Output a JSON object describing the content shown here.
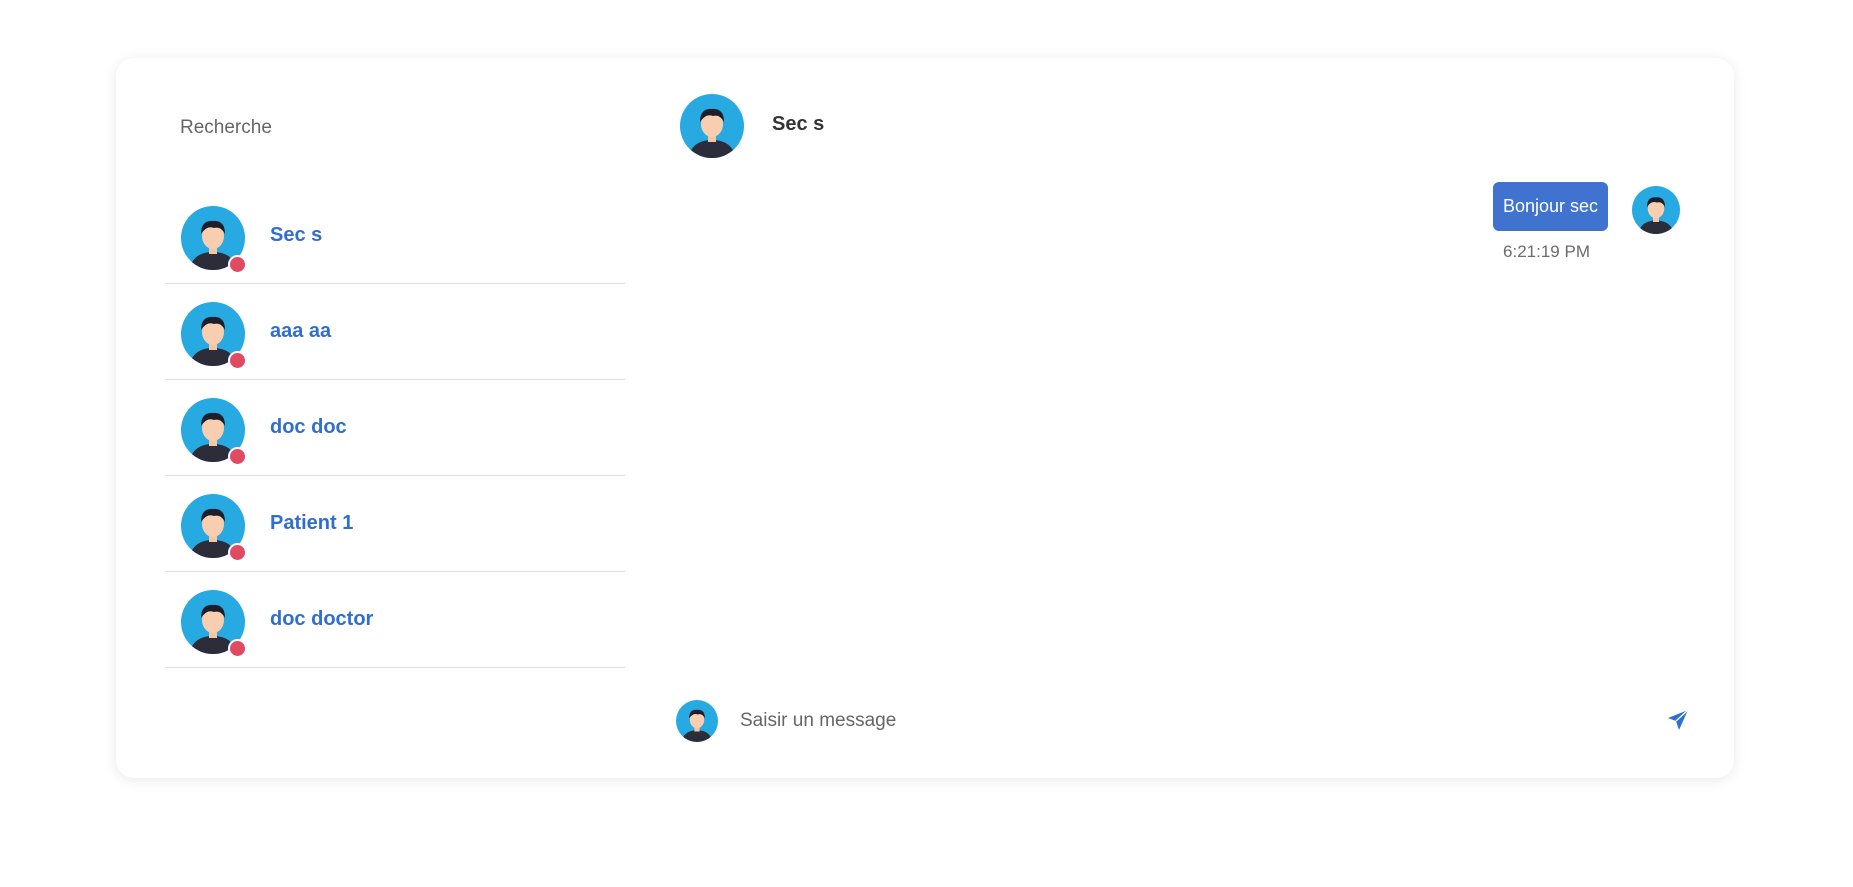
{
  "search": {
    "placeholder": "Recherche",
    "icon": "search-icon"
  },
  "status_color": "#e04a63",
  "accent_color": "#3f73cf",
  "contacts": [
    {
      "name": "Sec s",
      "status": "offline"
    },
    {
      "name": "aaa aa",
      "status": "offline"
    },
    {
      "name": "doc doc",
      "status": "offline"
    },
    {
      "name": "Patient 1",
      "status": "offline"
    },
    {
      "name": "doc doctor",
      "status": "offline"
    }
  ],
  "chat": {
    "title": "Sec s",
    "messages": [
      {
        "text": "Bonjour sec",
        "time": "6:21:19 PM",
        "from": "me"
      }
    ]
  },
  "composer": {
    "placeholder": "Saisir un message",
    "send_icon": "send-icon"
  }
}
